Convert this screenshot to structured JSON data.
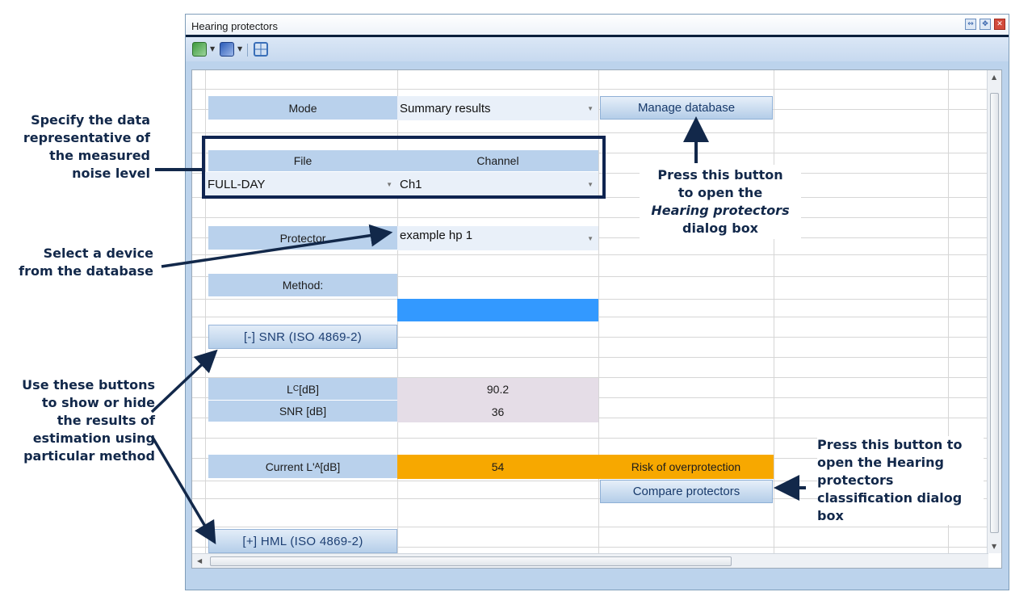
{
  "window": {
    "title": "Hearing protectors",
    "title_buttons": [
      "restore-icon",
      "maximize-icon",
      "close-icon"
    ]
  },
  "toolbar": {
    "buttons": [
      "export-excel-icon",
      "export-word-icon",
      "layout-grid-icon"
    ]
  },
  "sheet": {
    "mode_label": "Mode",
    "mode_value": "Summary results",
    "manage_database_label": "Manage database",
    "file_header": "File",
    "channel_header": "Channel",
    "file_value": "FULL-DAY",
    "channel_value": "Ch1",
    "protector_label": "Protector",
    "protector_value": "example hp 1",
    "method_label": "Method:",
    "snr_toggle": "[-]  SNR (ISO 4869-2)",
    "lc_label_main": "L",
    "lc_label_sub": "C",
    "lc_label_unit": " [dB]",
    "lc_value": "90.2",
    "snr_label": "SNR [dB]",
    "snr_value": "36",
    "current_la_label": "Current L'",
    "current_la_sub": "A",
    "current_la_unit": " [dB]",
    "current_la_value": "54",
    "risk_text": "Risk of overprotection",
    "compare_button": "Compare protectors",
    "hml_toggle": "[+]  HML (ISO 4869-2)"
  },
  "annotations": {
    "specify_data": [
      "Specify the data",
      "representative of",
      "the measured",
      "noise level"
    ],
    "select_device": [
      "Select a device",
      "from the database"
    ],
    "use_buttons": [
      "Use these buttons",
      "to show or hide",
      "the results of",
      "estimation using",
      "particular method"
    ],
    "press_button_1": "Press this button",
    "press_button_2": "to open the",
    "press_button_3": "Hearing protectors",
    "press_button_4": "dialog box",
    "press_compare": [
      "Press this button to",
      "open the Hearing",
      "protectors",
      "classification dialog",
      "box"
    ]
  },
  "colors": {
    "label_cell": "#b9d1ec",
    "value_cell": "#e5dde7",
    "warning": "#f7a800",
    "selection": "#3399ff",
    "annotation": "#12284a"
  }
}
